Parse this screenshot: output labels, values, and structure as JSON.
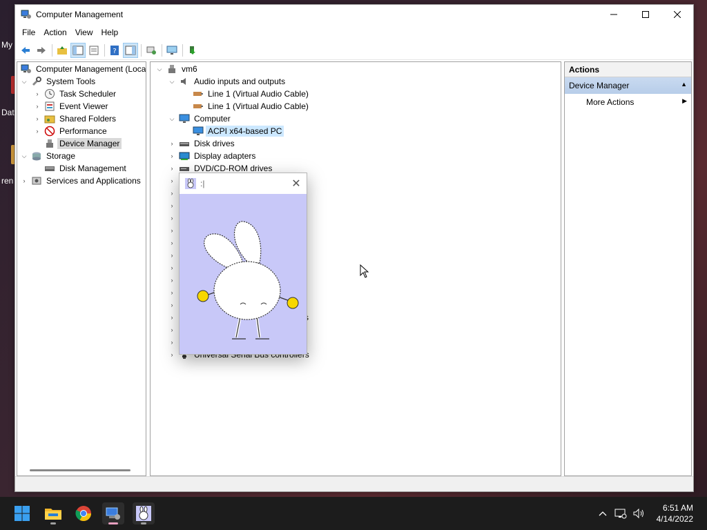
{
  "desktop": {
    "labels": [
      "My",
      "Dat",
      "ren"
    ]
  },
  "window": {
    "title": "Computer Management",
    "menu": [
      "File",
      "Action",
      "View",
      "Help"
    ]
  },
  "left_tree": {
    "root": "Computer Management (Local",
    "system_tools": "System Tools",
    "task_scheduler": "Task Scheduler",
    "event_viewer": "Event Viewer",
    "shared_folders": "Shared Folders",
    "performance": "Performance",
    "device_manager": "Device Manager",
    "storage": "Storage",
    "disk_management": "Disk Management",
    "services": "Services and Applications"
  },
  "device_tree": {
    "root": "vm6",
    "audio": "Audio inputs and outputs",
    "line1a": "Line 1 (Virtual Audio Cable)",
    "line1b": "Line 1 (Virtual Audio Cable)",
    "computer": "Computer",
    "acpi": "ACPI x64-based PC",
    "disk": "Disk drives",
    "display": "Display adapters",
    "dvd": "DVD/CD-ROM drives",
    "partial_a": "s",
    "partial_b": "llers",
    "usb": "Universal Serial Bus controllers"
  },
  "actions": {
    "header": "Actions",
    "section": "Device Manager",
    "more": "More Actions"
  },
  "popup": {
    "title": ":|"
  },
  "taskbar": {
    "time": "6:51 AM",
    "date": "4/14/2022"
  }
}
